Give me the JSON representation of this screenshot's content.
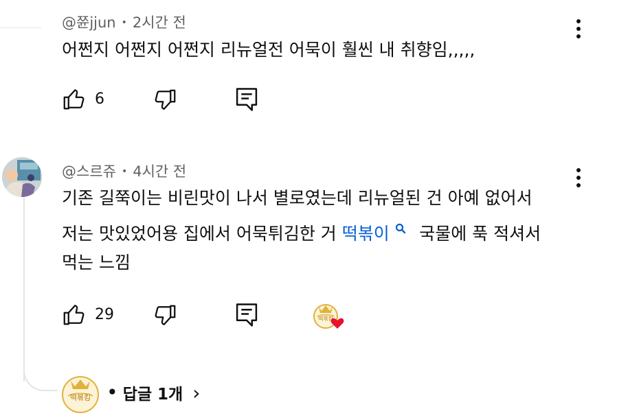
{
  "comments": [
    {
      "author": "@쮼jjun",
      "time": "2시간 전",
      "text": "어쩐지 어쩐지 어쩐지 리뉴얼전 어묵이 훨씬 내 취향임,,,,,",
      "likes": "6"
    },
    {
      "author": "@스르쥬",
      "time": "4시간 전",
      "line1": "기존 길쭉이는 비린맛이 나서 별로였는데 리뉴얼된 건 아예 없어서",
      "line2_pre": "저는 맛있었어용 집에서 어묵튀김한 거 ",
      "line2_link": "떡볶이",
      "line2_post": "국물에 푹 적셔서",
      "line3": "먹는 느낌",
      "likes": "29",
      "creator_badge_text": "떡볶킹"
    }
  ],
  "replies": {
    "label": "답글 1개",
    "bullet": "•",
    "chevron": "›",
    "badge_text": "떡볶킹"
  },
  "colors": {
    "link": "#065fd4",
    "meta": "#606060",
    "heart": "#e8112d",
    "badge_gold": "#e0b23c"
  },
  "icons": [
    "like-icon",
    "dislike-icon",
    "reply-icon",
    "more-icon",
    "search-icon",
    "heart-icon",
    "chevron-right-icon"
  ]
}
